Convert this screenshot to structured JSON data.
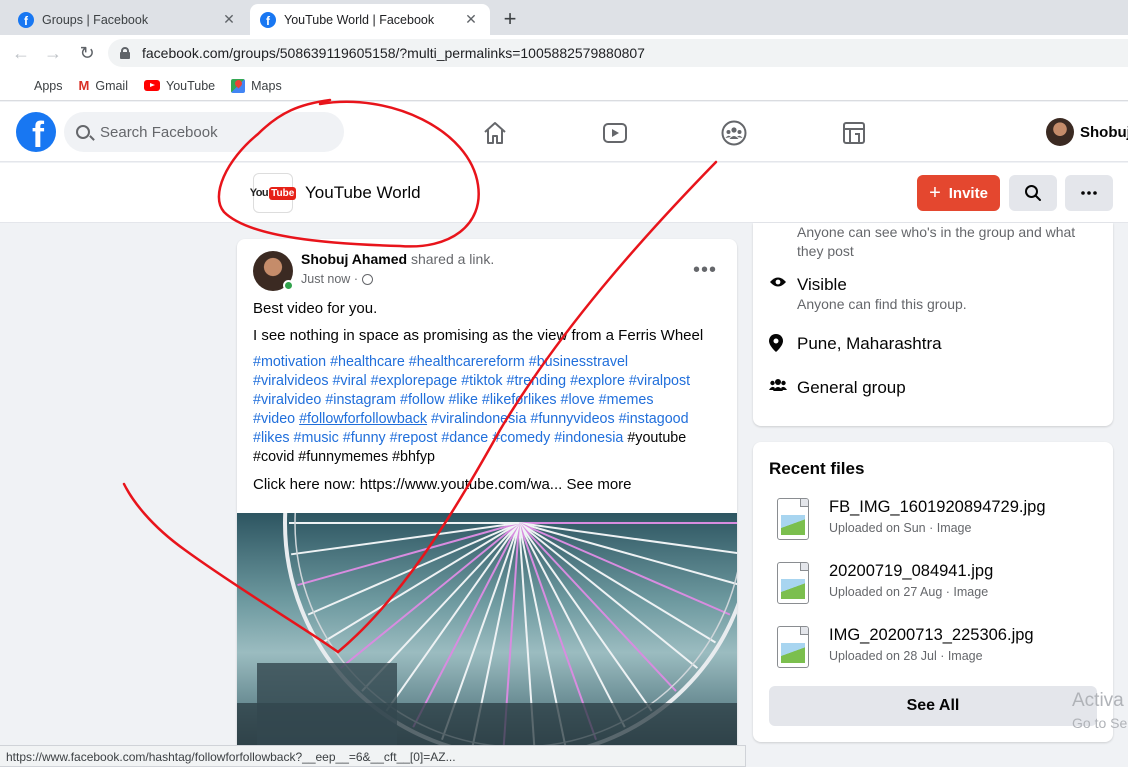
{
  "browser": {
    "tabs": [
      {
        "title": "Groups | Facebook",
        "active": false
      },
      {
        "title": "YouTube World | Facebook",
        "active": true
      }
    ],
    "new_tab": "+",
    "url": "facebook.com/groups/508639119605158/?multi_permalinks=1005882579880807",
    "bookmarks": [
      "Apps",
      "Gmail",
      "YouTube",
      "Maps"
    ],
    "status_url": "https://www.facebook.com/hashtag/followforfollowback?__eep__=6&__cft__[0]=AZ..."
  },
  "fbnav": {
    "logo": "f",
    "search_placeholder": "Search Facebook",
    "icons": [
      "home-icon",
      "watch-icon",
      "groups-icon",
      "gaming-icon"
    ],
    "profile_name": "Shobuj"
  },
  "group": {
    "name": "YouTube World",
    "thumb_you": "You",
    "thumb_tube": "Tube",
    "invite_label": "Invite"
  },
  "post": {
    "author": "Shobuj Ahamed",
    "action": "shared a link.",
    "time": "Just now",
    "line1": "Best video for you.",
    "line2": "I see nothing in space as promising as the view from a Ferris Wheel",
    "tags": {
      "row1": "#motivation #healthcare #healthcarereform #businesstravel",
      "row2": "#viralvideos #viral #explorepage #tiktok #trending #explore #viralpost",
      "row3": "#viralvideo #instagram #follow #like #likeforlikes #love #memes",
      "row4a": "#video ",
      "row4b": "#followforfollowback",
      "row4c": " #viralindonesia #funnyvideos #instagood",
      "row5a": "#likes #music #funny #repost #dance #comedy #indonesia ",
      "row5b": "#youtube",
      "row6": "#covid #funnymemes #bhfyp"
    },
    "link_text": "Click here now: https://www.youtube.com/wa...",
    "see_more": "See more"
  },
  "about": {
    "private_sub": "Anyone can see who's in the group and what they post",
    "visible_title": "Visible",
    "visible_sub": "Anyone can find this group.",
    "location": "Pune, Maharashtra",
    "type": "General group"
  },
  "recent_files": {
    "heading": "Recent files",
    "files": [
      {
        "name": "FB_IMG_1601920894729.jpg",
        "meta": "Uploaded on Sun · Image"
      },
      {
        "name": "20200719_084941.jpg",
        "meta": "Uploaded on 27 Aug · Image"
      },
      {
        "name": "IMG_20200713_225306.jpg",
        "meta": "Uploaded on 28 Jul · Image"
      }
    ],
    "see_all": "See All"
  },
  "watermark": {
    "line1": "Activa",
    "line2": "Go to Se"
  },
  "colors": {
    "fb_blue": "#1877f2",
    "invite_red": "#e4472f",
    "hashtag_blue": "#216fdb",
    "annotation_red": "#e8141b"
  }
}
